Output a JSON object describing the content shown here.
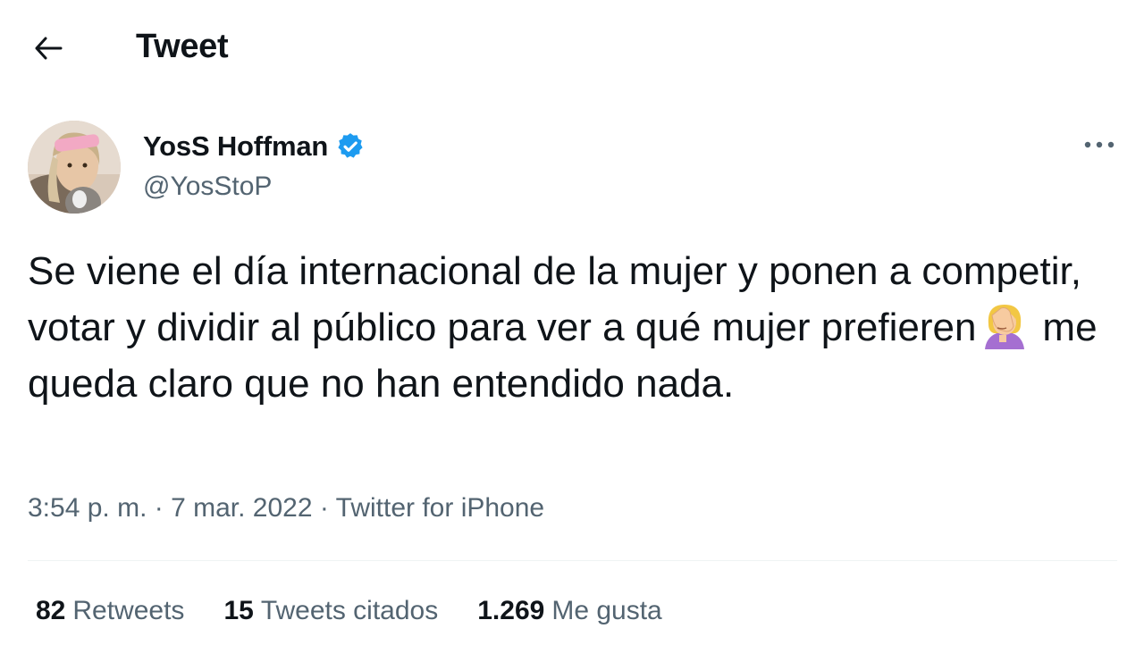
{
  "header": {
    "back_icon": "arrow-left-icon",
    "title": "Tweet"
  },
  "tweet": {
    "author": {
      "name": "YosS Hoffman",
      "handle": "@YosStoP",
      "verified": true,
      "verified_color": "#1d9bf0"
    },
    "text_parts": [
      "Se viene el día internacional de la mujer y ponen a competir, votar y dividir al público para ver a qué mujer prefieren",
      "me queda claro que no han entendido nada."
    ],
    "emoji": "woman-facepalming-emoji",
    "time": "3:54 p. m.",
    "date": "7 mar. 2022",
    "source": "Twitter for iPhone",
    "separator": "·",
    "more_icon": "more-horizontal-icon"
  },
  "stats": {
    "retweets": {
      "count": "82",
      "label": "Retweets"
    },
    "quotes": {
      "count": "15",
      "label": "Tweets citados"
    },
    "likes": {
      "count": "1.269",
      "label": "Me gusta"
    }
  },
  "colors": {
    "text_primary": "#0f1419",
    "text_secondary": "#536471",
    "divider": "#eff3f4",
    "verified": "#1d9bf0"
  }
}
